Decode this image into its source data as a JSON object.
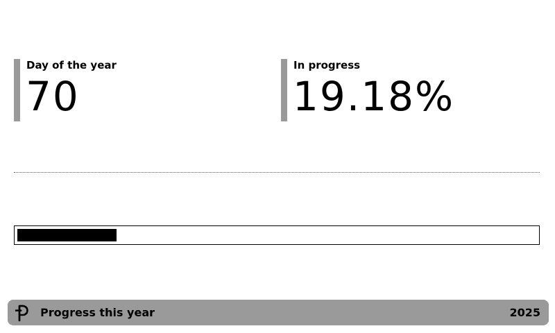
{
  "metrics": {
    "day": {
      "label": "Day of the year",
      "value": "70"
    },
    "progress": {
      "label": "In progress",
      "value": "19.18%"
    }
  },
  "progress_bar": {
    "percent": 19.18
  },
  "footer": {
    "logo_icon": "trmnl-logo-icon",
    "title": "Progress this year",
    "year": "2025"
  }
}
